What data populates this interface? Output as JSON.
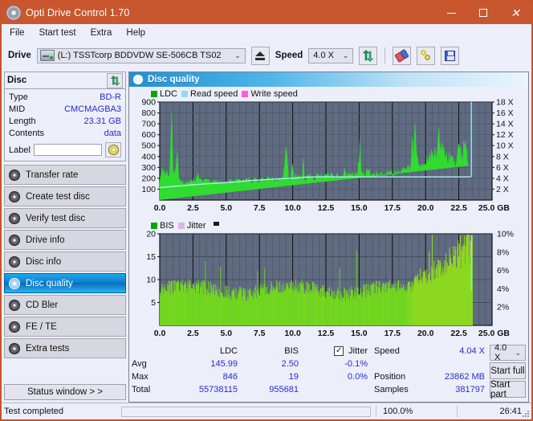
{
  "window": {
    "title": "Opti Drive Control 1.70",
    "app_icon": "disc-icon",
    "minimize": "–",
    "maximize": "□",
    "close": "✕",
    "accent": "#c8572f"
  },
  "menu": {
    "items": [
      "File",
      "Start test",
      "Extra",
      "Help"
    ]
  },
  "toolbar": {
    "drive_label": "Drive",
    "drive_value": "(L:)  TSSTcorp BDDVDW SE-506CB TS02",
    "eject_icon": "eject-icon",
    "speed_label": "Speed",
    "speed_value": "4.0 X",
    "refresh_icon": "refresh-icon",
    "erase_icon": "erase-icon",
    "plug_icon": "plug-icon",
    "save_icon": "save-icon"
  },
  "disc_panel": {
    "title": "Disc",
    "refresh_icon": "refresh-icon",
    "rows": [
      {
        "key": "Type",
        "value": "BD-R"
      },
      {
        "key": "MID",
        "value": "CMCMAGBA3"
      },
      {
        "key": "Length",
        "value": "23.31 GB"
      },
      {
        "key": "Contents",
        "value": "data"
      }
    ],
    "label_key": "Label",
    "label_value": "",
    "label_placeholder": "",
    "disc_icon": "cd-icon"
  },
  "sidebar": {
    "items": [
      {
        "label": "Transfer rate",
        "selected": false
      },
      {
        "label": "Create test disc",
        "selected": false
      },
      {
        "label": "Verify test disc",
        "selected": false
      },
      {
        "label": "Drive info",
        "selected": false
      },
      {
        "label": "Disc info",
        "selected": false
      },
      {
        "label": "Disc quality",
        "selected": true
      },
      {
        "label": "CD Bler",
        "selected": false
      },
      {
        "label": "FE / TE",
        "selected": false
      },
      {
        "label": "Extra tests",
        "selected": false
      }
    ],
    "status_window_label": "Status window > >"
  },
  "main": {
    "header_title": "Disc quality",
    "header_icon": "disc-quality-icon"
  },
  "stats": {
    "col_headers": [
      "LDC",
      "BIS"
    ],
    "jitter_label": "Jitter",
    "jitter_checked": true,
    "rows": [
      {
        "name": "Avg",
        "ldc": "145.99",
        "bis": "2.50",
        "jitter": "-0.1%"
      },
      {
        "name": "Max",
        "ldc": "846",
        "bis": "19",
        "jitter": "0.0%"
      },
      {
        "name": "Total",
        "ldc": "55738115",
        "bis": "955681",
        "jitter": ""
      }
    ],
    "speed_label": "Speed",
    "speed_value": "4.04 X",
    "position_label": "Position",
    "position_value": "23862 MB",
    "samples_label": "Samples",
    "samples_value": "381797",
    "speed_select": "4.0 X",
    "start_full": "Start full",
    "start_part": "Start part"
  },
  "footer": {
    "status": "Test completed",
    "progress_percent": 100,
    "progress_text": "100.0%",
    "elapsed": "26:41",
    "progress_color": "#13b113"
  },
  "chart_data": [
    {
      "type": "area",
      "id": "ldc-chart",
      "title": "Disc quality - LDC",
      "xlabel": "GB",
      "ylabel": "",
      "xlim": [
        0,
        25
      ],
      "ylim": [
        0,
        900
      ],
      "y2lim": [
        0,
        18
      ],
      "y2label": "X",
      "xticks": [
        "0.0",
        "2.5",
        "5.0",
        "7.5",
        "10.0",
        "12.5",
        "15.0",
        "17.5",
        "20.0",
        "22.5",
        "25.0 GB"
      ],
      "yticks": [
        100,
        200,
        300,
        400,
        500,
        600,
        700,
        800,
        900
      ],
      "y2ticks": [
        "2 X",
        "4 X",
        "6 X",
        "8 X",
        "10 X",
        "12 X",
        "14 X",
        "16 X",
        "18 X"
      ],
      "grid": true,
      "plot_bg": "#5f6b80",
      "legend": [
        {
          "label": "LDC",
          "color": "#00b000"
        },
        {
          "label": "Read speed",
          "color": "#7fdcf5"
        },
        {
          "label": "Write speed",
          "color": "#ff5ce0"
        }
      ],
      "data_end_x": 23.5,
      "series": [
        {
          "name": "LDC",
          "color": "#2ad52a",
          "x": [
            0.0,
            0.15,
            0.3,
            0.45,
            0.6,
            0.75,
            0.9,
            1.0,
            1.1,
            1.2,
            1.3,
            1.4,
            1.5,
            1.7,
            1.9,
            2.1,
            2.3,
            2.5,
            2.7,
            2.9,
            3.1,
            3.3,
            3.5,
            3.7,
            3.9,
            4.1,
            4.3,
            4.5,
            4.7,
            4.9,
            5.1,
            5.3,
            5.5,
            5.7,
            5.9,
            6.1,
            6.3,
            6.5,
            6.7,
            6.9,
            7.1,
            7.3,
            7.5,
            7.7,
            7.9,
            8.1,
            8.3,
            8.5,
            8.7,
            8.9,
            9.1,
            9.3,
            9.5,
            9.7,
            9.85,
            9.95,
            10.1,
            10.3,
            10.5,
            10.7,
            10.8,
            10.9,
            11.1,
            11.3,
            11.5,
            11.7,
            11.9,
            12.1,
            12.3,
            12.5,
            12.7,
            12.9,
            13.1,
            13.3,
            13.5,
            13.7,
            13.9,
            14.0,
            14.1,
            14.3,
            14.5,
            14.7,
            14.9,
            15.05,
            15.15,
            15.3,
            15.5,
            15.7,
            15.9,
            16.1,
            16.3,
            16.5,
            16.7,
            16.9,
            17.1,
            17.3,
            17.5,
            17.7,
            17.9,
            18.1,
            18.3,
            18.5,
            18.7,
            18.9,
            19.0,
            19.1,
            19.2,
            19.3,
            19.4,
            19.5,
            19.7,
            19.9,
            20.1,
            20.3,
            20.5,
            20.7,
            20.9,
            21.0,
            21.1,
            21.3,
            21.4,
            21.5,
            21.7,
            21.9,
            22.1,
            22.3,
            22.5,
            22.7,
            22.8,
            22.9,
            23.0,
            23.1,
            23.2,
            23.3,
            23.4,
            23.5
          ],
          "y": [
            160,
            300,
            250,
            235,
            280,
            230,
            845,
            260,
            255,
            300,
            470,
            260,
            180,
            175,
            175,
            180,
            175,
            185,
            180,
            250,
            200,
            175,
            180,
            185,
            180,
            175,
            180,
            185,
            180,
            175,
            185,
            180,
            175,
            180,
            190,
            185,
            180,
            185,
            190,
            185,
            190,
            195,
            190,
            195,
            200,
            210,
            200,
            195,
            200,
            205,
            200,
            210,
            560,
            215,
            210,
            330,
            250,
            215,
            215,
            215,
            360,
            215,
            215,
            225,
            225,
            220,
            225,
            220,
            225,
            230,
            225,
            230,
            225,
            230,
            235,
            230,
            300,
            280,
            235,
            235,
            240,
            235,
            240,
            540,
            250,
            240,
            245,
            300,
            250,
            245,
            250,
            255,
            250,
            255,
            260,
            255,
            260,
            265,
            270,
            275,
            280,
            290,
            300,
            320,
            560,
            420,
            690,
            480,
            430,
            350,
            330,
            340,
            380,
            430,
            440,
            460,
            480,
            630,
            500,
            490,
            450,
            440,
            410,
            390,
            380,
            370,
            620,
            400,
            390,
            620,
            560,
            450,
            400,
            390
          ]
        },
        {
          "name": "Read speed",
          "color": "#9fe8f8",
          "x": [
            0.0,
            1.0,
            2.0,
            3.0,
            4.0,
            5.0,
            6.0,
            7.0,
            8.0,
            9.0,
            10.0,
            11.0,
            12.0,
            14.0,
            16.0,
            18.0,
            20.0,
            22.0,
            23.4
          ],
          "y_x": [
            2.3,
            2.5,
            2.7,
            2.9,
            3.05,
            3.2,
            3.4,
            3.6,
            3.75,
            3.9,
            4.0,
            4.2,
            4.25,
            4.25,
            4.25,
            4.25,
            4.25,
            4.25,
            4.25
          ]
        }
      ],
      "read_speed_marker_x": 23.45
    },
    {
      "type": "bar",
      "id": "bis-jitter-chart",
      "title": "Disc quality - BIS / Jitter",
      "xlabel": "GB",
      "xlim": [
        0,
        25
      ],
      "ylim": [
        0,
        20
      ],
      "y2lim": [
        0,
        10
      ],
      "y2label": "%",
      "xticks": [
        "0.0",
        "2.5",
        "5.0",
        "7.5",
        "10.0",
        "12.5",
        "15.0",
        "17.5",
        "20.0",
        "22.5",
        "25.0 GB"
      ],
      "yticks": [
        5,
        10,
        15,
        20
      ],
      "y2ticks": [
        "2%",
        "4%",
        "6%",
        "8%",
        "10%"
      ],
      "grid": true,
      "plot_bg": "#5f6b80",
      "legend": [
        {
          "label": "BIS",
          "color": "#00b000"
        },
        {
          "label": "Jitter",
          "color": "#d9b8e8"
        }
      ],
      "data_end_x": 23.5,
      "series": [
        {
          "name": "BIS",
          "color": "#6fdc20",
          "avg_low": 5.5,
          "avg_high": 9.5,
          "late_avg_low": 8.0,
          "late_avg_high": 14.0
        },
        {
          "name": "Jitter",
          "color": "#d8d820",
          "note": "yellow overlay increasing after 19.0 GB"
        }
      ]
    }
  ]
}
